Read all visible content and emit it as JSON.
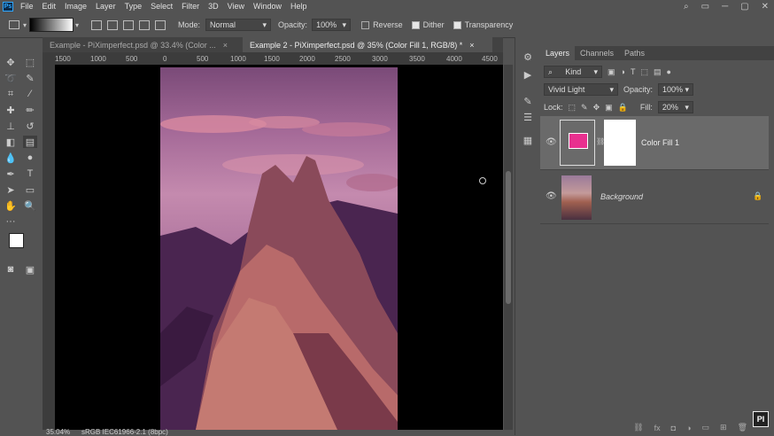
{
  "menu": {
    "logo": "Ps",
    "items": [
      "File",
      "Edit",
      "Image",
      "Layer",
      "Type",
      "Select",
      "Filter",
      "3D",
      "View",
      "Window",
      "Help"
    ]
  },
  "window_controls": [
    "⌕",
    "▭",
    "─",
    "▢",
    "✕"
  ],
  "options": {
    "mode_label": "Mode:",
    "mode_value": "Normal",
    "opacity_label": "Opacity:",
    "opacity_value": "100%",
    "reverse_label": "Reverse",
    "reverse_checked": false,
    "dither_label": "Dither",
    "dither_checked": true,
    "transparency_label": "Transparency",
    "transparency_checked": true
  },
  "tabs": [
    {
      "label": "Example - PiXimperfect.psd @ 33.4% (Color ...",
      "close": "×",
      "active": false
    },
    {
      "label": "Example 2 - PiXimperfect.psd @ 35% (Color Fill 1, RGB/8) *",
      "close": "×",
      "active": true
    }
  ],
  "ruler_ticks": [
    "1500",
    "1000",
    "500",
    "0",
    "500",
    "1000",
    "1500",
    "2000",
    "2500",
    "3000",
    "3500",
    "4000",
    "4500"
  ],
  "status": {
    "zoom": "35.04%",
    "profile": "sRGB IEC61966-2.1 (8bpc)"
  },
  "panel": {
    "tabs": [
      "Layers",
      "Channels",
      "Paths"
    ],
    "filter_label": "Kind",
    "blend_mode": "Vivid Light",
    "opacity_label": "Opacity:",
    "opacity_value": "100%",
    "lock_label": "Lock:",
    "fill_label": "Fill:",
    "fill_value": "20%",
    "layers": [
      {
        "name": "Color Fill 1",
        "swatch_color": "#e8308f",
        "selected": true
      },
      {
        "name": "Background",
        "locked": true,
        "selected": false
      }
    ],
    "footer_icons": [
      "link-icon",
      "fx-icon",
      "mask-icon",
      "adjustment-icon",
      "group-icon",
      "new-layer-icon",
      "trash-icon"
    ],
    "footer_glyphs": [
      "⛓",
      "fx",
      "◘",
      "◑",
      "▭",
      "⊞",
      "🗑"
    ]
  },
  "colors": {
    "accent_fill": "#e8308f",
    "panel_bg": "#535353",
    "selected_layer_bg": "#6a6a6a"
  }
}
